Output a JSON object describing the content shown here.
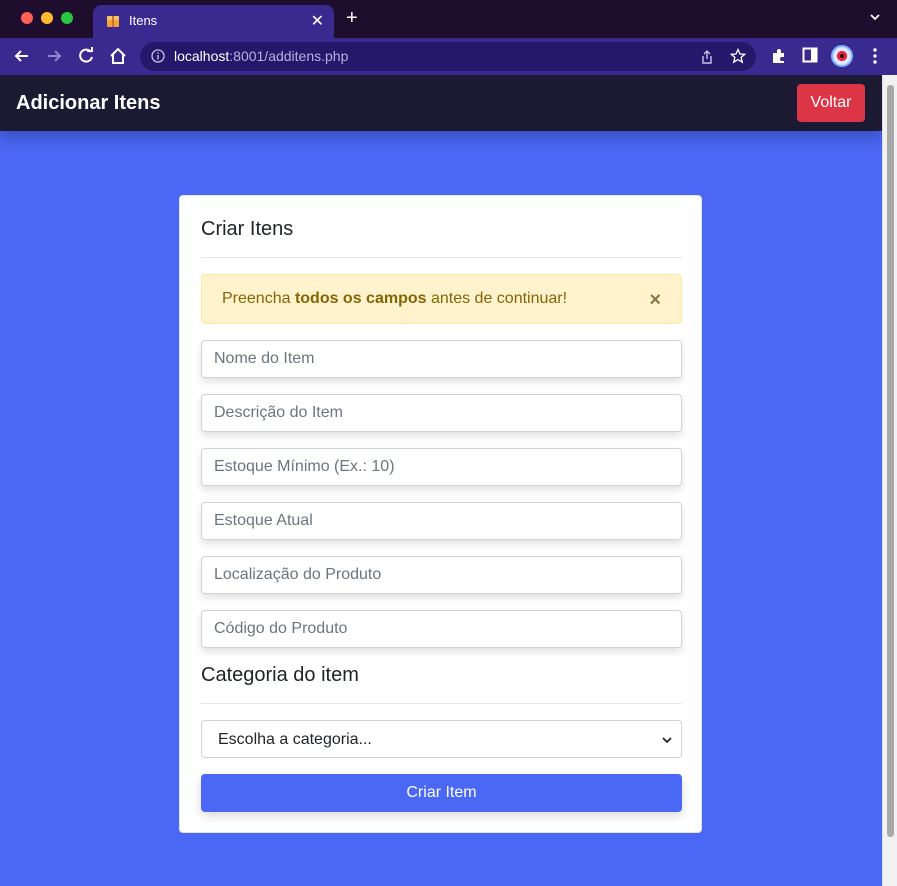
{
  "browser": {
    "tab_title": "Itens",
    "tab_close_icon": "close-icon",
    "new_tab_label": "+",
    "url_host": "localhost",
    "url_rest": ":8001/additens.php"
  },
  "navbar": {
    "title": "Adicionar Itens",
    "back_button_label": "Voltar"
  },
  "card": {
    "title": "Criar Itens",
    "alert": {
      "prefix": "Preencha ",
      "bold": "todos os campos",
      "suffix": " antes de continuar!",
      "close_label": "×"
    },
    "fields": {
      "name_placeholder": "Nome do Item",
      "description_placeholder": "Descrição do Item",
      "min_stock_placeholder": "Estoque Mínimo (Ex.: 10)",
      "current_stock_placeholder": "Estoque Atual",
      "location_placeholder": "Localização do Produto",
      "code_placeholder": "Código do Produto"
    },
    "category_title": "Categoria do item",
    "category_select_value": "Escolha a categoria...",
    "submit_label": "Criar Item"
  },
  "colors": {
    "page_background": "#4a67f5",
    "navbar": "#1c1a33",
    "back_button": "#dc3545",
    "submit_button": "#4a67f5",
    "alert_background": "#fff3cd",
    "alert_text": "#856404"
  }
}
